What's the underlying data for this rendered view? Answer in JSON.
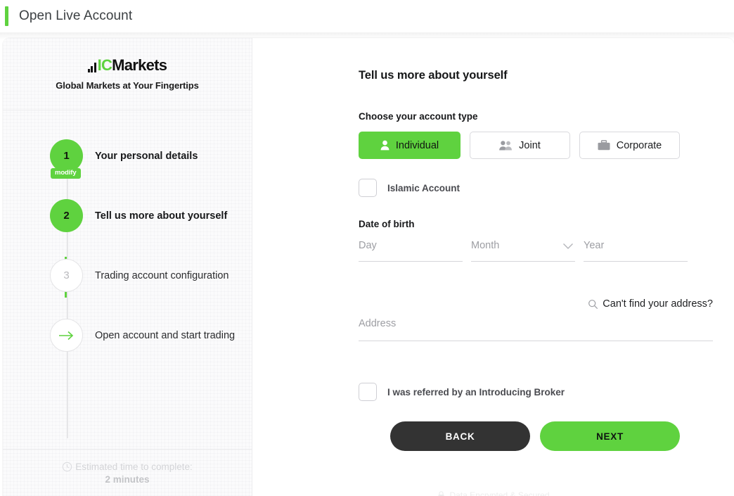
{
  "header": {
    "title": "Open Live Account",
    "accent_color": "#5fd23f"
  },
  "sidebar": {
    "brand": {
      "logo_mark": "bar-chart-mark",
      "name_part1": "IC",
      "name_part2": "Markets",
      "tagline": "Global Markets at Your Fingertips"
    },
    "steps": [
      {
        "number": "1",
        "label": "Your personal details",
        "state": "done",
        "badge": "modify"
      },
      {
        "number": "2",
        "label": "Tell us more about yourself",
        "state": "current",
        "badge": null
      },
      {
        "number": "3",
        "label": "Trading account configuration",
        "state": "todo",
        "badge": null
      },
      {
        "number": "",
        "label": "Open account and start trading",
        "state": "finish",
        "badge": null,
        "icon": "arrow-right-icon"
      }
    ],
    "footer": {
      "icon": "clock-icon",
      "eta_label": "Estimated time to complete:",
      "eta_value": "2 minutes"
    }
  },
  "main": {
    "title": "Tell us more about yourself",
    "account_type": {
      "label": "Choose your account type",
      "options": [
        {
          "label": "Individual",
          "icon": "person-icon",
          "selected": true
        },
        {
          "label": "Joint",
          "icon": "people-icon",
          "selected": false
        },
        {
          "label": "Corporate",
          "icon": "briefcase-icon",
          "selected": false
        }
      ]
    },
    "islamic_account": {
      "label": "Islamic Account",
      "checked": false
    },
    "date_of_birth": {
      "label": "Date of birth",
      "day": {
        "placeholder": "Day",
        "value": ""
      },
      "month": {
        "placeholder": "Month",
        "value": "",
        "icon": "chevron-down-icon"
      },
      "year": {
        "placeholder": "Year",
        "value": ""
      }
    },
    "address": {
      "help_link": "Can't find your address?",
      "help_icon": "search-icon",
      "placeholder": "Address",
      "value": ""
    },
    "introducing_broker": {
      "label": "I was referred by an Introducing Broker",
      "checked": false
    },
    "actions": {
      "back_label": "BACK",
      "next_label": "NEXT"
    },
    "secure_note": {
      "icon": "lock-icon",
      "text": "Data Encrypted & Secured"
    }
  }
}
